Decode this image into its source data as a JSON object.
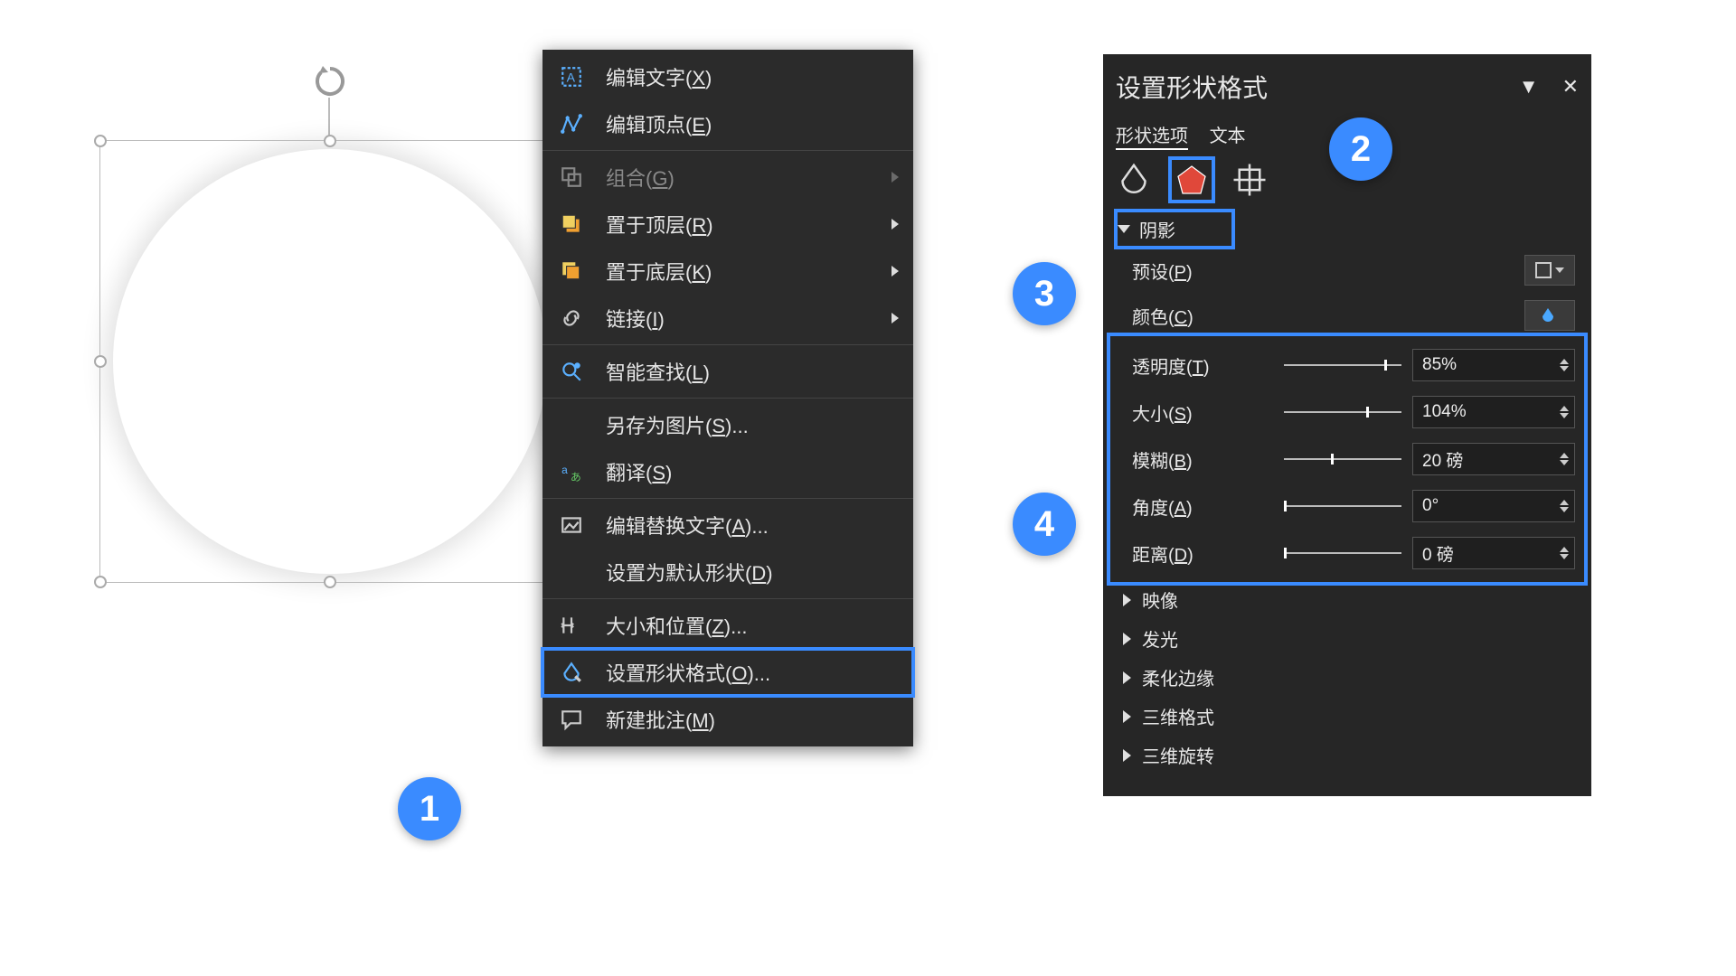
{
  "context_menu": {
    "items": [
      {
        "label_pre": "编辑文字(",
        "key": "X",
        "label_post": ")",
        "icon": "edit-text-icon",
        "arrow": false,
        "disabled": false
      },
      {
        "label_pre": "编辑顶点(",
        "key": "E",
        "label_post": ")",
        "icon": "edit-points-icon",
        "arrow": false,
        "disabled": false
      },
      {
        "label_pre": "组合(",
        "key": "G",
        "label_post": ")",
        "icon": "group-icon",
        "arrow": true,
        "disabled": true
      },
      {
        "label_pre": "置于顶层(",
        "key": "R",
        "label_post": ")",
        "icon": "bring-front-icon",
        "arrow": true,
        "disabled": false
      },
      {
        "label_pre": "置于底层(",
        "key": "K",
        "label_post": ")",
        "icon": "send-back-icon",
        "arrow": true,
        "disabled": false
      },
      {
        "label_pre": "链接(",
        "key": "I",
        "label_post": ")",
        "icon": "link-icon",
        "arrow": true,
        "disabled": false
      },
      {
        "label_pre": "智能查找(",
        "key": "L",
        "label_post": ")",
        "icon": "smart-lookup-icon",
        "arrow": false,
        "disabled": false
      },
      {
        "label_pre": "另存为图片(",
        "key": "S",
        "label_post": ")...",
        "icon": "",
        "arrow": false,
        "disabled": false
      },
      {
        "label_pre": "翻译(",
        "key": "S",
        "label_post": ")",
        "icon": "translate-icon",
        "arrow": false,
        "disabled": false
      },
      {
        "label_pre": "编辑替换文字(",
        "key": "A",
        "label_post": ")...",
        "icon": "alt-text-icon",
        "arrow": false,
        "disabled": false
      },
      {
        "label_pre": "设置为默认形状(",
        "key": "D",
        "label_post": ")",
        "icon": "",
        "arrow": false,
        "disabled": false
      },
      {
        "label_pre": "大小和位置(",
        "key": "Z",
        "label_post": ")...",
        "icon": "size-position-icon",
        "arrow": false,
        "disabled": false
      },
      {
        "label_pre": "设置形状格式(",
        "key": "O",
        "label_post": ")...",
        "icon": "format-shape-icon",
        "arrow": false,
        "disabled": false,
        "highlight": true
      },
      {
        "label_pre": "新建批注(",
        "key": "M",
        "label_post": ")",
        "icon": "new-comment-icon",
        "arrow": false,
        "disabled": false
      }
    ]
  },
  "format_pane": {
    "title": "设置形状格式",
    "tabs": {
      "shape": "形状选项",
      "text": "文本"
    },
    "section_shadow": {
      "label": "阴影"
    },
    "preset": {
      "label_pre": "预设(",
      "key": "P",
      "label_post": ")"
    },
    "color": {
      "label_pre": "颜色(",
      "key": "C",
      "label_post": ")"
    },
    "transparency": {
      "label_pre": "透明度(",
      "key": "T",
      "label_post": ")",
      "value": "85%",
      "pos": 85
    },
    "size": {
      "label_pre": "大小(",
      "key": "S",
      "label_post": ")",
      "value": "104%",
      "pos": 70
    },
    "blur": {
      "label_pre": "模糊(",
      "key": "B",
      "label_post": ")",
      "value": "20 磅",
      "pos": 40
    },
    "angle": {
      "label_pre": "角度(",
      "key": "A",
      "label_post": ")",
      "value": "0°",
      "pos": 0
    },
    "distance": {
      "label_pre": "距离(",
      "key": "D",
      "label_post": ")",
      "value": "0 磅",
      "pos": 0
    },
    "other_sections": [
      "映像",
      "发光",
      "柔化边缘",
      "三维格式",
      "三维旋转"
    ]
  },
  "badges": {
    "b1": "1",
    "b2": "2",
    "b3": "3",
    "b4": "4"
  }
}
